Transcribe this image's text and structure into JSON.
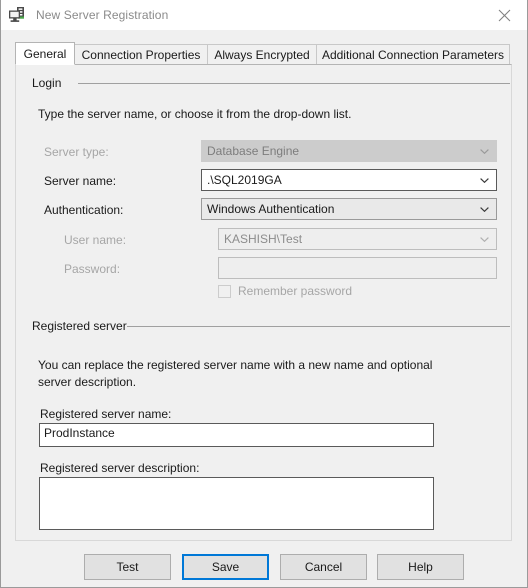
{
  "window": {
    "title": "New Server Registration",
    "icon": "server-registration-icon",
    "close_label": "Close"
  },
  "tabs": [
    {
      "label": "General",
      "active": true
    },
    {
      "label": "Connection Properties",
      "active": false
    },
    {
      "label": "Always Encrypted",
      "active": false
    },
    {
      "label": "Additional Connection Parameters",
      "active": false
    }
  ],
  "login_group": {
    "title": "Login",
    "instruction": "Type the server name, or choose it from the drop-down list.",
    "fields": {
      "server_type": {
        "label": "Server type:",
        "value": "Database Engine",
        "disabled": true
      },
      "server_name": {
        "label": "Server name:",
        "value": ".\\SQL2019GA",
        "disabled": false
      },
      "authentication": {
        "label": "Authentication:",
        "value": "Windows Authentication",
        "disabled": false
      },
      "user_name": {
        "label": "User name:",
        "value": "KASHISH\\Test",
        "disabled": true
      },
      "password": {
        "label": "Password:",
        "value": "",
        "disabled": true
      },
      "remember_password": {
        "label": "Remember password",
        "checked": false,
        "disabled": true
      }
    }
  },
  "registered_server_group": {
    "title": "Registered server",
    "description_text": "You can replace the registered server name with a new name and optional server description.",
    "name_field": {
      "label": "Registered server name:",
      "value": "ProdInstance"
    },
    "description_field": {
      "label": "Registered server description:",
      "value": ""
    }
  },
  "buttons": [
    {
      "label": "Test",
      "default": false
    },
    {
      "label": "Save",
      "default": true
    },
    {
      "label": "Cancel",
      "default": false
    },
    {
      "label": "Help",
      "default": false
    }
  ],
  "colors": {
    "accent": "#0078d7",
    "dialog_bg": "#f0f0f0",
    "titlebar_bg": "#ffffff",
    "disabled_text": "#a6a6a6",
    "icon_accent": "#4aa84a"
  }
}
